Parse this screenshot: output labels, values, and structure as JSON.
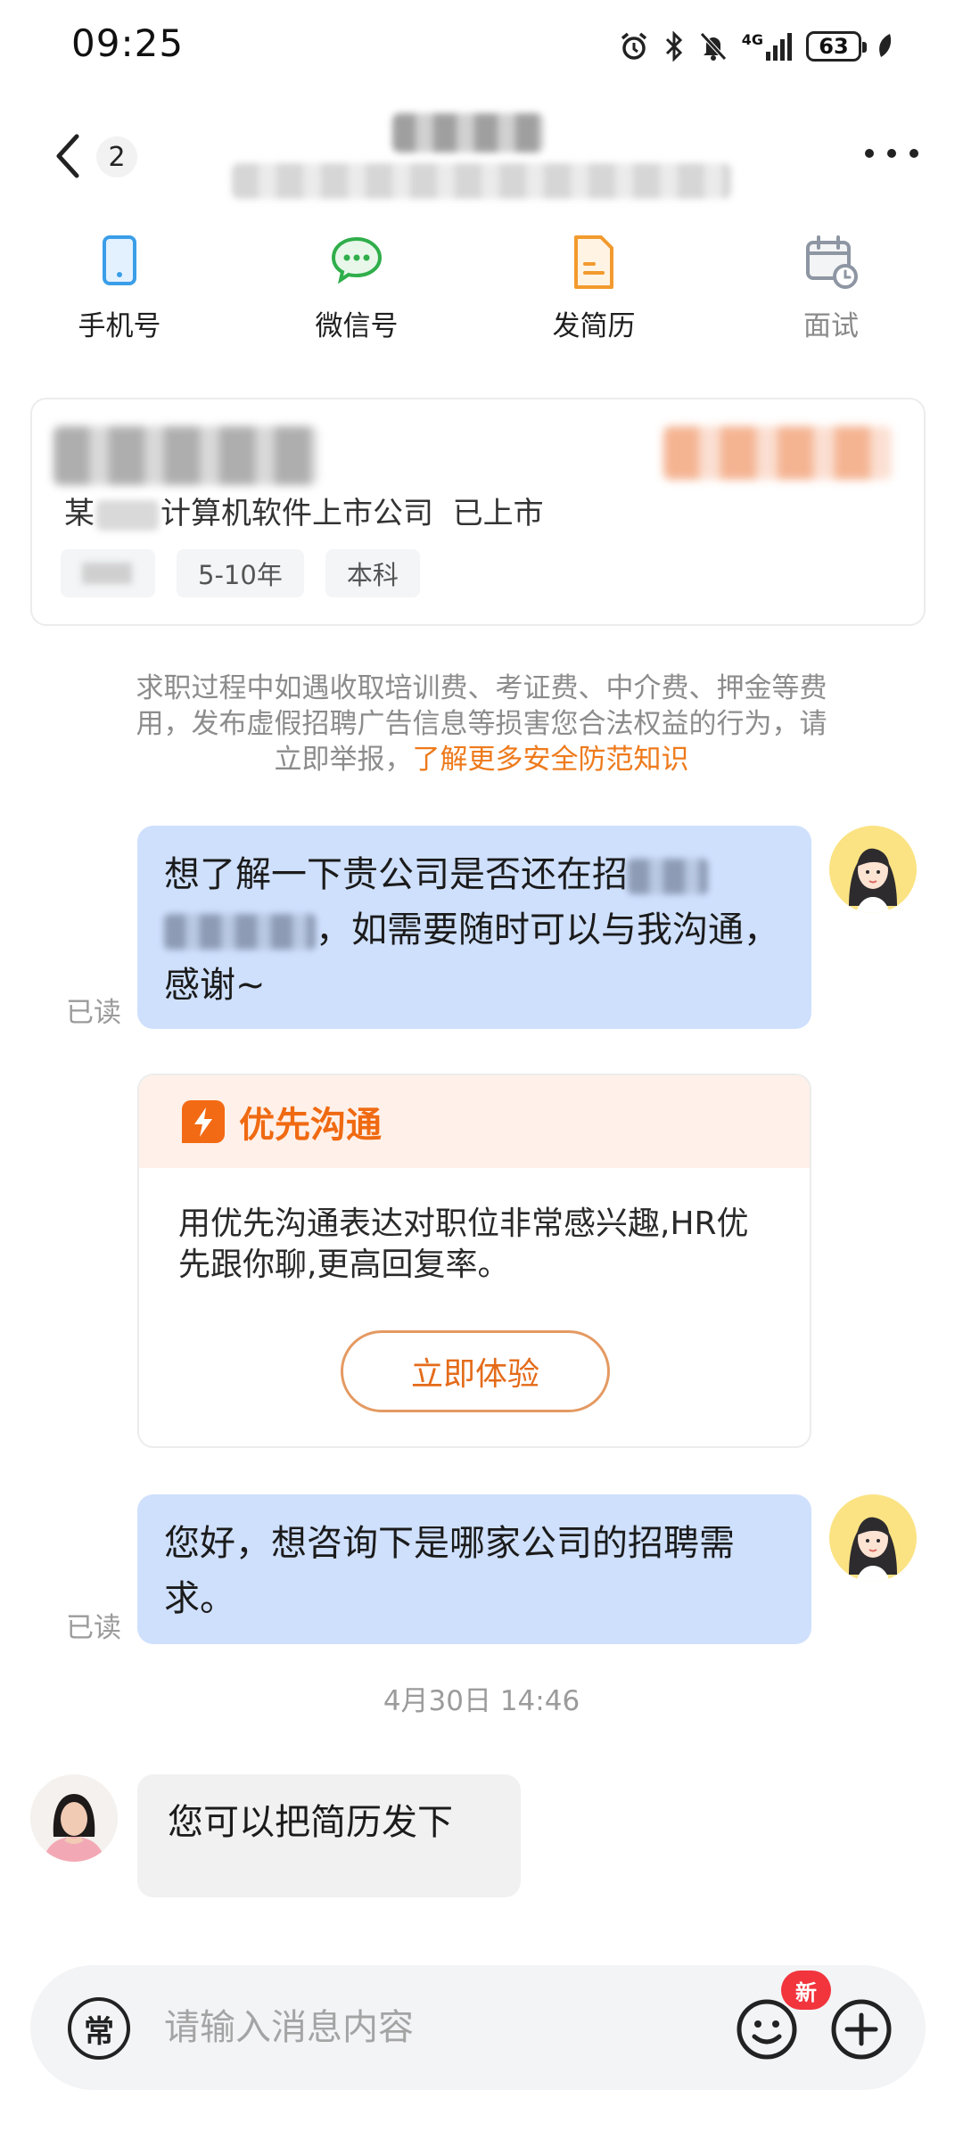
{
  "status_bar": {
    "time": "09:25",
    "network": "4G",
    "battery": "63",
    "icons": [
      "alarm-icon",
      "bluetooth-icon",
      "mute-icon",
      "signal-icon",
      "battery-icon",
      "leaf-icon"
    ]
  },
  "header": {
    "unread_count": "2"
  },
  "actions": {
    "phone": "手机号",
    "wechat": "微信号",
    "resume": "发简历",
    "interview": "面试"
  },
  "job": {
    "company_prefix": "某",
    "company_suffix": "计算机软件上市公司",
    "listing_status": "已上市",
    "experience": "5-10年",
    "education": "本科"
  },
  "notice": {
    "text": "求职过程中如遇收取培训费、考证费、中介费、押金等费用，发布虚假招聘广告信息等损害您合法权益的行为，请立即举报，",
    "link": "了解更多安全防范知识"
  },
  "messages": {
    "msg1_part1": "想了解一下贵公司是否还在招",
    "msg1_part2": "，如需要随时可以与我沟通，感谢~",
    "msg1_read": "已读",
    "priority_title": "优先沟通",
    "priority_text": "用优先沟通表达对职位非常感兴趣,HR优先跟你聊,更高回复率。",
    "priority_button": "立即体验",
    "msg2": "您好，想咨询下是哪家公司的招聘需求。",
    "msg2_read": "已读",
    "timestamp": "4月30日 14:46",
    "hr_msg": "您可以把简历发下"
  },
  "input": {
    "frequent_label": "常",
    "placeholder": "请输入消息内容",
    "new_badge": "新"
  },
  "colors": {
    "accent_orange": "#f06a12",
    "bubble_blue": "#cfe0fd",
    "new_badge_red": "#f2343d"
  }
}
